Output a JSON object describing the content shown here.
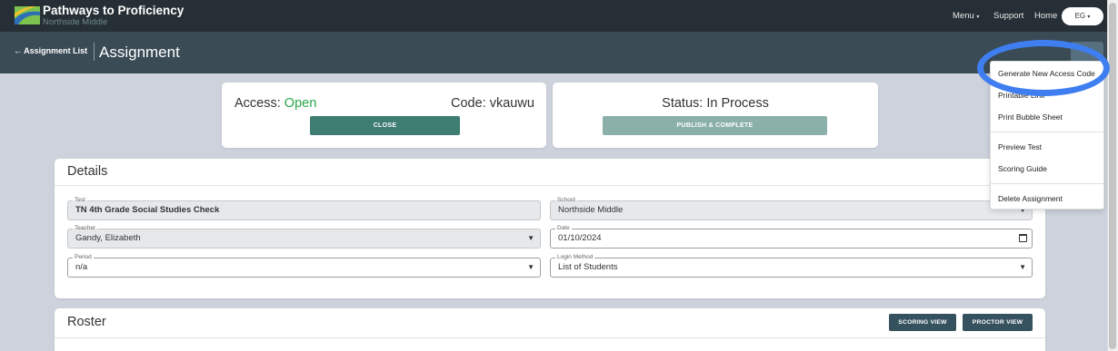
{
  "header": {
    "brand": "Pathways to Proficiency",
    "school": "Northside Middle",
    "nav": {
      "menu": "Menu",
      "support": "Support",
      "home": "Home"
    },
    "user_initials": "EG"
  },
  "subheader": {
    "back_link": "Assignment List",
    "title": "Assignment"
  },
  "access_card": {
    "access_label": "Access:",
    "access_value": "Open",
    "code_label": "Code:",
    "code_value": "vkauwu",
    "close_button": "CLOSE"
  },
  "status_card": {
    "status": "Status: In Process",
    "publish_button": "PUBLISH & COMPLETE"
  },
  "details": {
    "title": "Details",
    "test": {
      "label": "Test",
      "value": "TN 4th Grade Social Studies Check"
    },
    "school": {
      "label": "School",
      "value": "Northside Middle"
    },
    "teacher": {
      "label": "Teacher",
      "value": "Gandy, Elizabeth"
    },
    "date": {
      "label": "Date",
      "value": "01/10/2024"
    },
    "period": {
      "label": "Period",
      "value": "n/a"
    },
    "login_method": {
      "label": "Login Method",
      "value": "List of Students"
    }
  },
  "roster": {
    "title": "Roster",
    "scoring_view_button": "SCORING VIEW",
    "proctor_view_button": "PROCTOR VIEW"
  },
  "dropdown_menu": {
    "items": [
      "Generate New Access Code",
      "Printable Link",
      "Print Bubble Sheet",
      "Preview Test",
      "Scoring Guide",
      "Delete Assignment"
    ]
  },
  "colors": {
    "topbar": "#262f35",
    "subbar": "#3a4b55",
    "access_open": "#28a745",
    "close_button": "#3e7d72",
    "highlight_ring": "#3f7ef0"
  }
}
